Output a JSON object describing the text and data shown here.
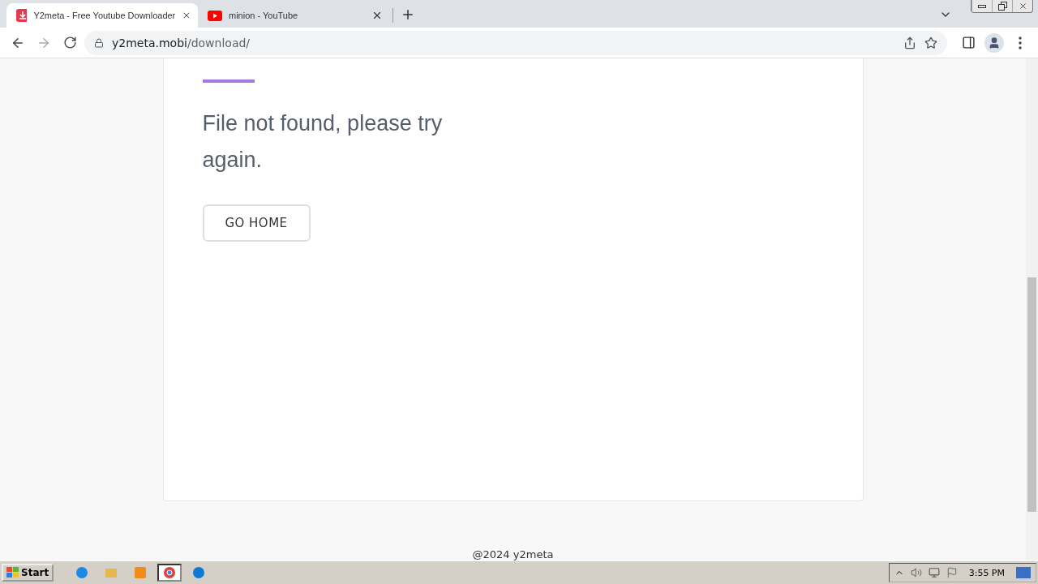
{
  "browser": {
    "tabs": [
      {
        "title": "Y2meta - Free Youtube Downloader",
        "kind": "download",
        "selected": true
      },
      {
        "title": "minion - YouTube",
        "kind": "youtube",
        "selected": false
      }
    ],
    "address": {
      "host": "y2meta.mobi",
      "path": "/download/"
    }
  },
  "page": {
    "message": "File not found, please try again.",
    "button": "GO HOME",
    "footer": "@2024 y2meta"
  },
  "taskbar": {
    "start": "Start",
    "apps": [
      {
        "kind": "ie",
        "selected": false
      },
      {
        "kind": "folder",
        "selected": false
      },
      {
        "kind": "media",
        "selected": false
      },
      {
        "kind": "chrome",
        "selected": true
      },
      {
        "kind": "edge",
        "selected": false
      }
    ],
    "clock": "3:55 PM"
  }
}
